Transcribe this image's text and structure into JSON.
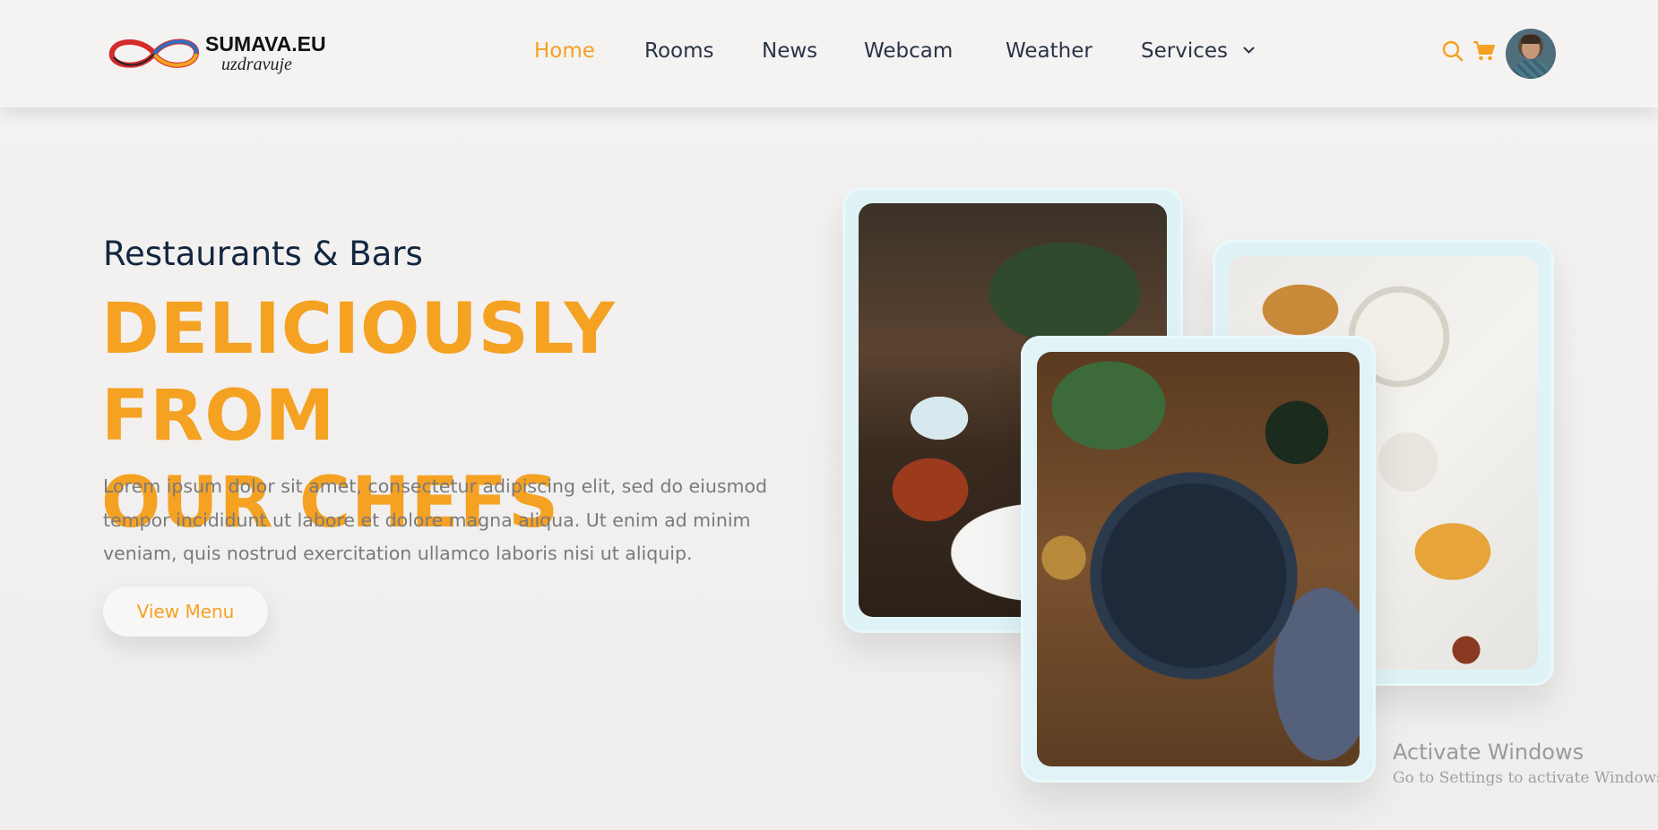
{
  "brand": {
    "name": "SUMAVA.EU",
    "tagline": "uzdravuje"
  },
  "nav": {
    "items": [
      {
        "label": "Home",
        "active": true
      },
      {
        "label": "Rooms",
        "active": false
      },
      {
        "label": "News",
        "active": false
      },
      {
        "label": "Webcam",
        "active": false
      },
      {
        "label": "Weather",
        "active": false
      },
      {
        "label": "Services",
        "active": false,
        "has_dropdown": true
      }
    ]
  },
  "header_icons": [
    "search-icon",
    "cart-icon",
    "avatar"
  ],
  "hero": {
    "eyebrow": "Restaurants & Bars",
    "headline_line1": "DELICIOUSLY FROM",
    "headline_line2": "OUR CHEFS",
    "description": "Lorem ipsum dolor sit amet, consectetur adipiscing elit, sed do eiusmod tempor incididunt ut labore et dolore magna aliqua. Ut enim ad minim veniam, quis nostrud exercitation ullamco laboris nisi ut aliquip.",
    "cta_label": "View Menu"
  },
  "gallery": {
    "images": [
      "restaurant-interior-photo",
      "breakfast-table-photo",
      "salad-bowl-photo"
    ]
  },
  "watermark": {
    "title": "Activate Windows",
    "subtitle": "Go to Settings to activate Windows."
  },
  "colors": {
    "accent": "#f5a122",
    "heading": "#132640",
    "text": "#7a7a7a",
    "card_frame": "#dff3f6"
  }
}
